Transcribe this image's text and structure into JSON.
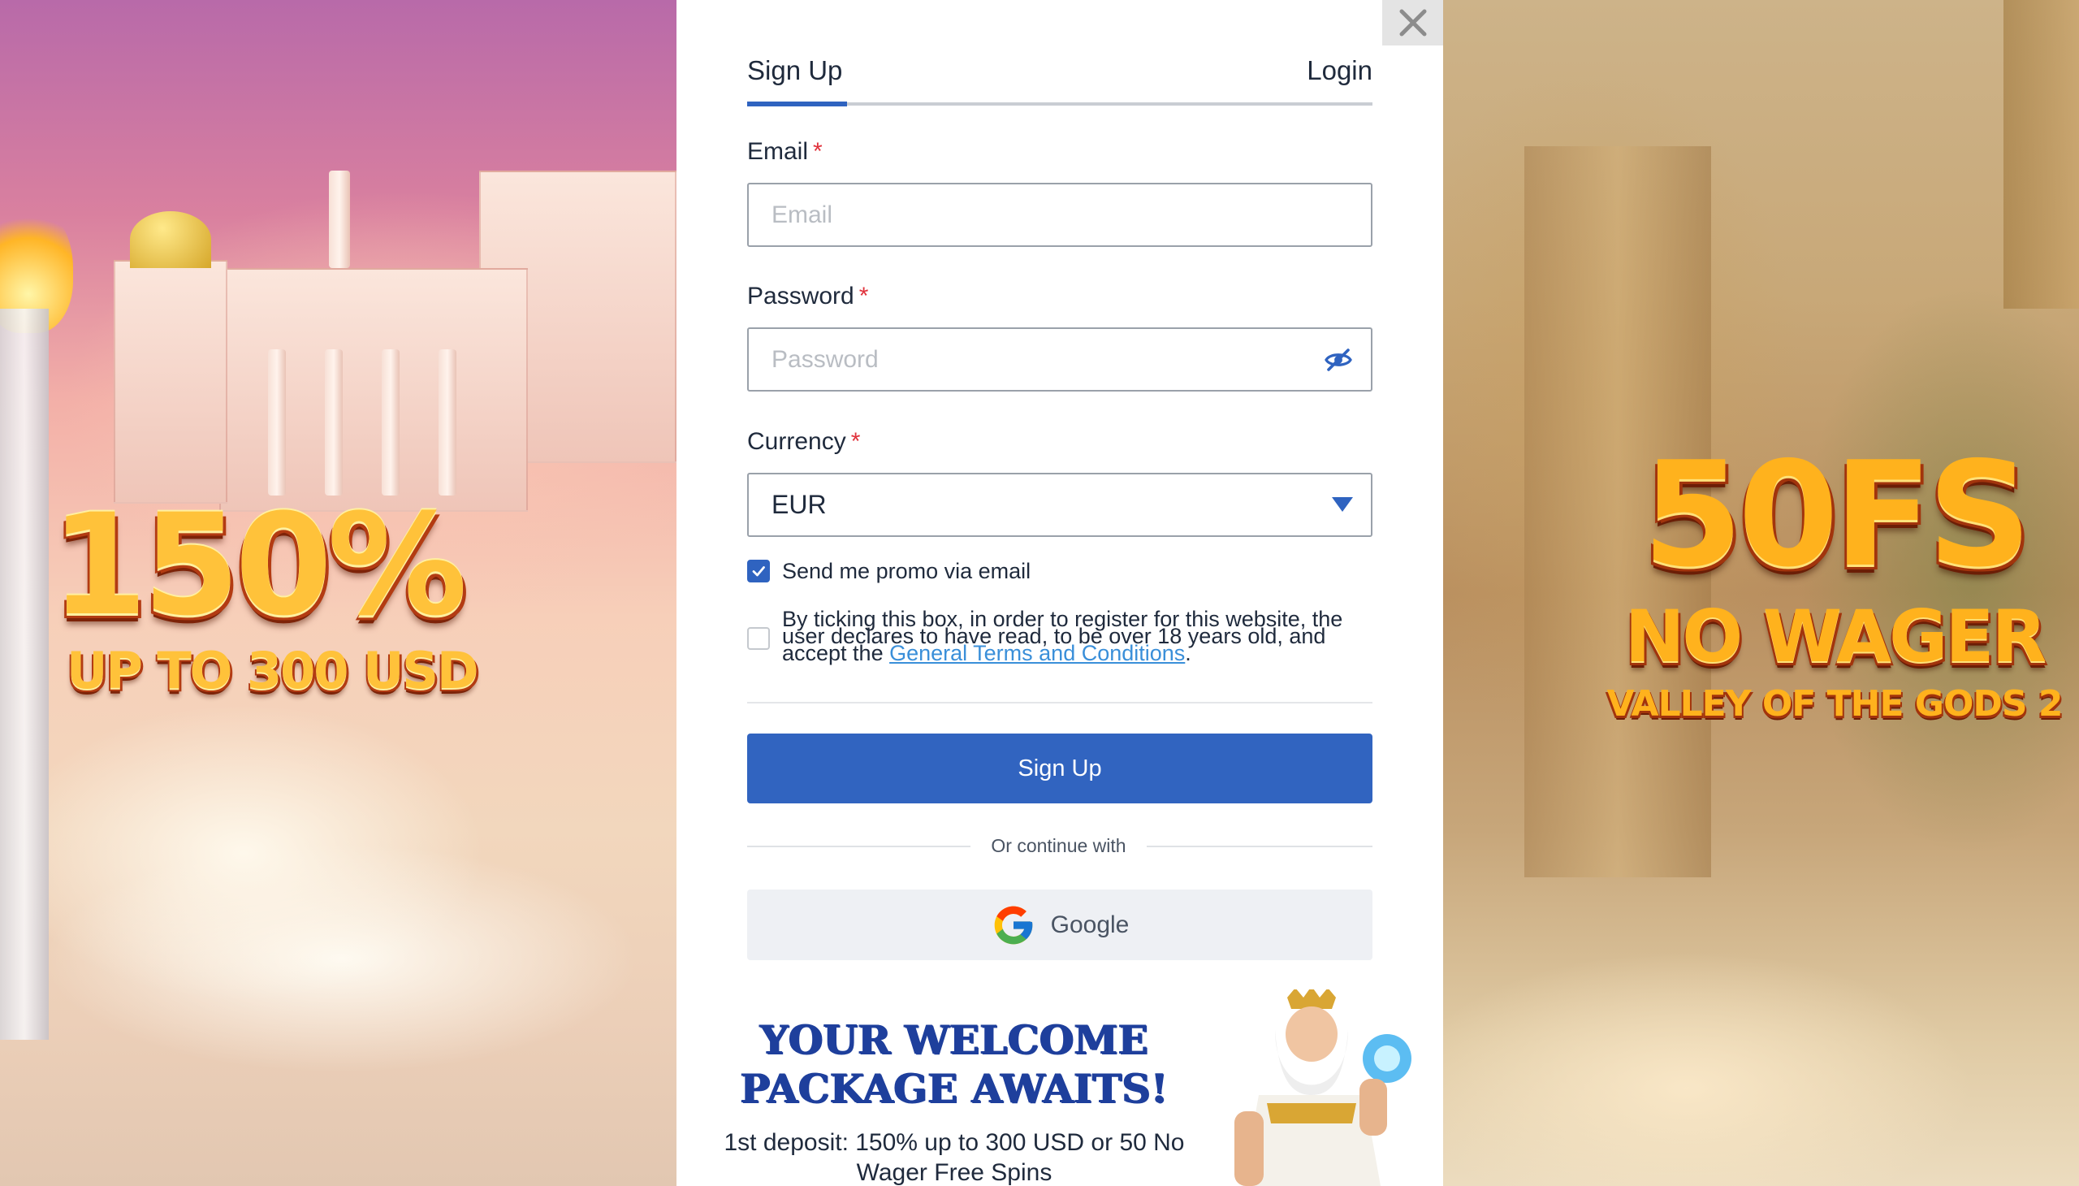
{
  "left_promo": {
    "headline": "150%",
    "subline": "UP TO 300 USD"
  },
  "right_promo": {
    "headline": "50FS",
    "subline": "NO WAGER",
    "game": "VALLEY OF THE GODS 2"
  },
  "modal": {
    "tabs": {
      "signup": "Sign Up",
      "login": "Login",
      "active": "signup"
    },
    "email": {
      "label": "Email",
      "required_mark": "*",
      "placeholder": "Email",
      "value": ""
    },
    "password": {
      "label": "Password",
      "required_mark": "*",
      "placeholder": "Password",
      "value": ""
    },
    "currency": {
      "label": "Currency",
      "required_mark": "*",
      "selected": "EUR"
    },
    "promo_checkbox": {
      "label": "Send me promo via email",
      "checked": true
    },
    "terms_checkbox": {
      "text_before": "By ticking this box, in order to register for this website, the user declares to have read, to be over 18 years old, and accept the ",
      "link_text": "General Terms and Conditions",
      "text_after": ".",
      "checked": false
    },
    "submit_label": "Sign Up",
    "or_continue": "Or continue with",
    "google_label": "Google",
    "welcome": {
      "title": "YOUR WELCOME PACKAGE AWAITS!",
      "description": "1st deposit: 150% up to 300 USD or 50 No Wager Free Spins"
    }
  },
  "colors": {
    "accent": "#3164c0",
    "required": "#e0323c",
    "link": "#3a8fd9",
    "welcome_title": "#1e3f9c"
  },
  "icons": [
    "close-icon",
    "eye-slash-icon",
    "chevron-down-icon",
    "checkmark-icon",
    "google-icon"
  ]
}
